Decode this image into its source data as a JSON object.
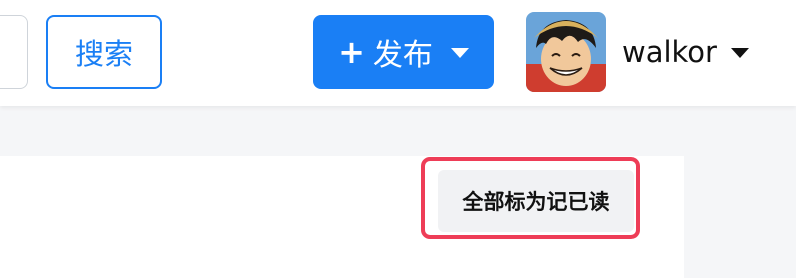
{
  "header": {
    "search_button_label": "搜索",
    "publish_button": {
      "plus_symbol": "+",
      "label": "发布"
    },
    "user": {
      "username": "walkor"
    }
  },
  "notifications": {
    "mark_all_read_label": "全部标为记已读"
  },
  "colors": {
    "primary": "#1a7ff5",
    "highlight": "#ee3d57"
  }
}
